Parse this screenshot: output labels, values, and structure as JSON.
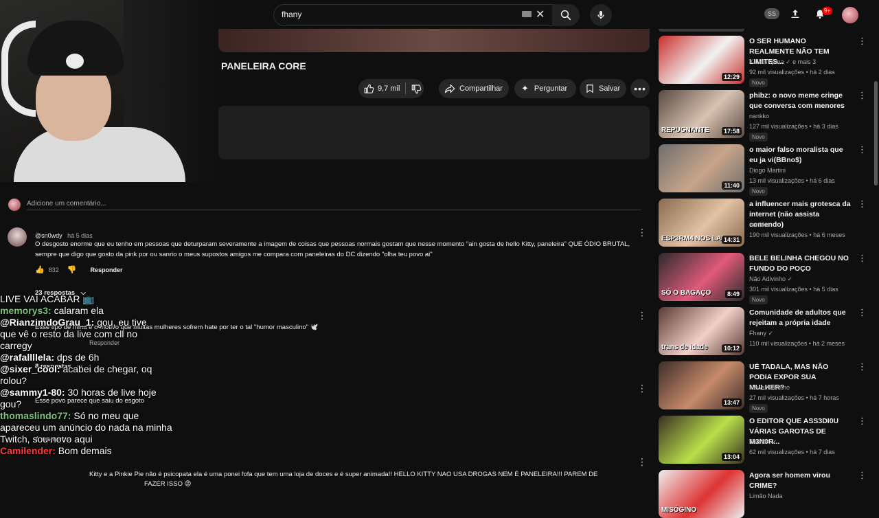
{
  "header": {
    "search_value": "fhany",
    "ss_badge": "SS",
    "notifications": "9+"
  },
  "video": {
    "title": "PANELEIRA CORE",
    "likes": "9,7 mil",
    "share_label": "Compartilhar",
    "ask_label": "Perguntar",
    "save_label": "Salvar"
  },
  "comments": {
    "add_placeholder": "Adicione um comentário...",
    "items": [
      {
        "author": "@sn0wdy",
        "time": "há 5 dias",
        "text": "O desgosto enorme que eu tenho em pessoas que deturparam severamente a imagem de coisas que pessoas normais gostam que nesse momento \"ain gosta de hello Kitty, paneleira\" QUE ÓDIO BRUTAL, sempre que digo que gosto da pink por ou sanrio o meus supostos amigos me compara com paneleiras do DC dizendo \"olha teu povo ai\"",
        "likes": "832",
        "reply_label": "Responder",
        "replies": "23 respostas"
      },
      {
        "text": "Esse tipo de mina é o motivo que muitas mulheres sofrem hate por ter o tal \"humor masculino\" 🕊️",
        "reply_label": "Responder",
        "replies": "8 respostas"
      },
      {
        "text": "Esse povo parece que saiu do esgoto",
        "replies": "4 respostas"
      },
      {
        "text": "Kitty e a Pinkie Pie não é psicopata ela é uma ponei fofa que tem uma loja de doces e é super animada!! HELLO KITTY NAO USA DROGAS NEM É PANELEIRA!!! PAREM DE",
        "text2": "FAZER ISSO 😡"
      }
    ]
  },
  "chat": [
    {
      "name": "",
      "msg": "LIVE VAI ACABAR 📺"
    },
    {
      "name": "memorys3:",
      "msg": " calaram ela",
      "color": "#7cc47a"
    },
    {
      "name": "@RianzimdoGrau_1:",
      "msg": " gou, eu tive",
      "color": "#ffffff"
    },
    {
      "name": "",
      "msg": "que vê o resto da live com cll no"
    },
    {
      "name": "",
      "msg": "carregy"
    },
    {
      "name": "@rafallllela:",
      "msg": " dps de 6h",
      "color": "#ffffff"
    },
    {
      "name": "@sixer_cool:",
      "msg": " acabei de chegar, oq",
      "color": "#ffffff"
    },
    {
      "name": "",
      "msg": "rolou?"
    },
    {
      "name": "@sammy1-80:",
      "msg": " 30 horas de live hoje",
      "color": "#ffffff"
    },
    {
      "name": "",
      "msg": "gou?"
    },
    {
      "name": "thomaslindo77:",
      "msg": " Só no meu que",
      "color": "#7cc47a"
    },
    {
      "name": "",
      "msg": "apareceu um anúncio do nada na minha"
    },
    {
      "name": "",
      "msg": "Twitch, sou novo aqui"
    },
    {
      "name": "Camilender:",
      "msg": " Bom demais",
      "color": "#ff3b3b"
    }
  ],
  "recommendations": [
    {
      "title": "O SER HUMANO REALMENTE NÃO TEM LIMITES...",
      "channel": "Kauan opina ✓ e mais 3",
      "meta": "92 mil visualizações • há 2 dias",
      "badge": "Novo",
      "duration": "12:29",
      "c1": "#c9302c",
      "c2": "#f2f2f2"
    },
    {
      "title": "phibz: o novo meme cringe que conversa com menores",
      "channel": "nankko",
      "meta": "127 mil visualizações • há 3 dias",
      "badge": "Novo",
      "duration": "17:58",
      "overlay": "REPUGNANTE",
      "c1": "#5a4a42",
      "c2": "#d8c3b2"
    },
    {
      "title": "o maior falso moralista que eu ja vi(BBno$)",
      "channel": "Diogo Martini",
      "meta": "13 mil visualizações • há 6 dias",
      "badge": "Novo",
      "duration": "11:40",
      "c1": "#6e6e6e",
      "c2": "#c9a58a"
    },
    {
      "title": "a influencer mais grotesca da internet (não assista comendo)",
      "channel": "nankko",
      "meta": "190 mil visualizações • há 6 meses",
      "badge": "",
      "duration": "14:31",
      "overlay": "ESP3RM4 NOS LAB",
      "c1": "#8a6b4f",
      "c2": "#e2c1a4"
    },
    {
      "title": "BELE BELINHA CHEGOU NO FUNDO DO POÇO",
      "channel": "Não Adivinho ✓",
      "meta": "301 mil visualizações • há 5 dias",
      "badge": "Novo",
      "duration": "8:49",
      "overlay": "SÓ O BAGAÇO",
      "c1": "#2b2b2b",
      "c2": "#e05a7a"
    },
    {
      "title": "Comunidade de adultos que rejeitam a própria idade",
      "channel": "Fhany ✓",
      "meta": "110 mil visualizações • há 2 meses",
      "badge": "",
      "duration": "10:12",
      "overlay": "trans de idade",
      "c1": "#5b3a34",
      "c2": "#f0d0c8"
    },
    {
      "title": "UÉ TADALA, MAS NÃO PODIA EXPOR SUA MULHER?",
      "channel": "News Adivinho",
      "meta": "27 mil visualizações • há 7 horas",
      "badge": "Novo",
      "duration": "13:47",
      "c1": "#3d2e2a",
      "c2": "#c78a6a"
    },
    {
      "title": "O EDITOR QUE ASS3DI0U VÁRIAS GAROTAS DE M3N0R...",
      "channel": "The DK ✓",
      "meta": "62 mil visualizações • há 7 dias",
      "badge": "",
      "duration": "13:04",
      "c1": "#3a2f22",
      "c2": "#b8e04a"
    },
    {
      "title": "Agora ser homem virou CRIME?",
      "channel": "Limão Nada",
      "meta": "",
      "badge": "",
      "duration": "",
      "overlay": "MISÓGINO",
      "c1": "#eeeeee",
      "c2": "#d33"
    }
  ]
}
